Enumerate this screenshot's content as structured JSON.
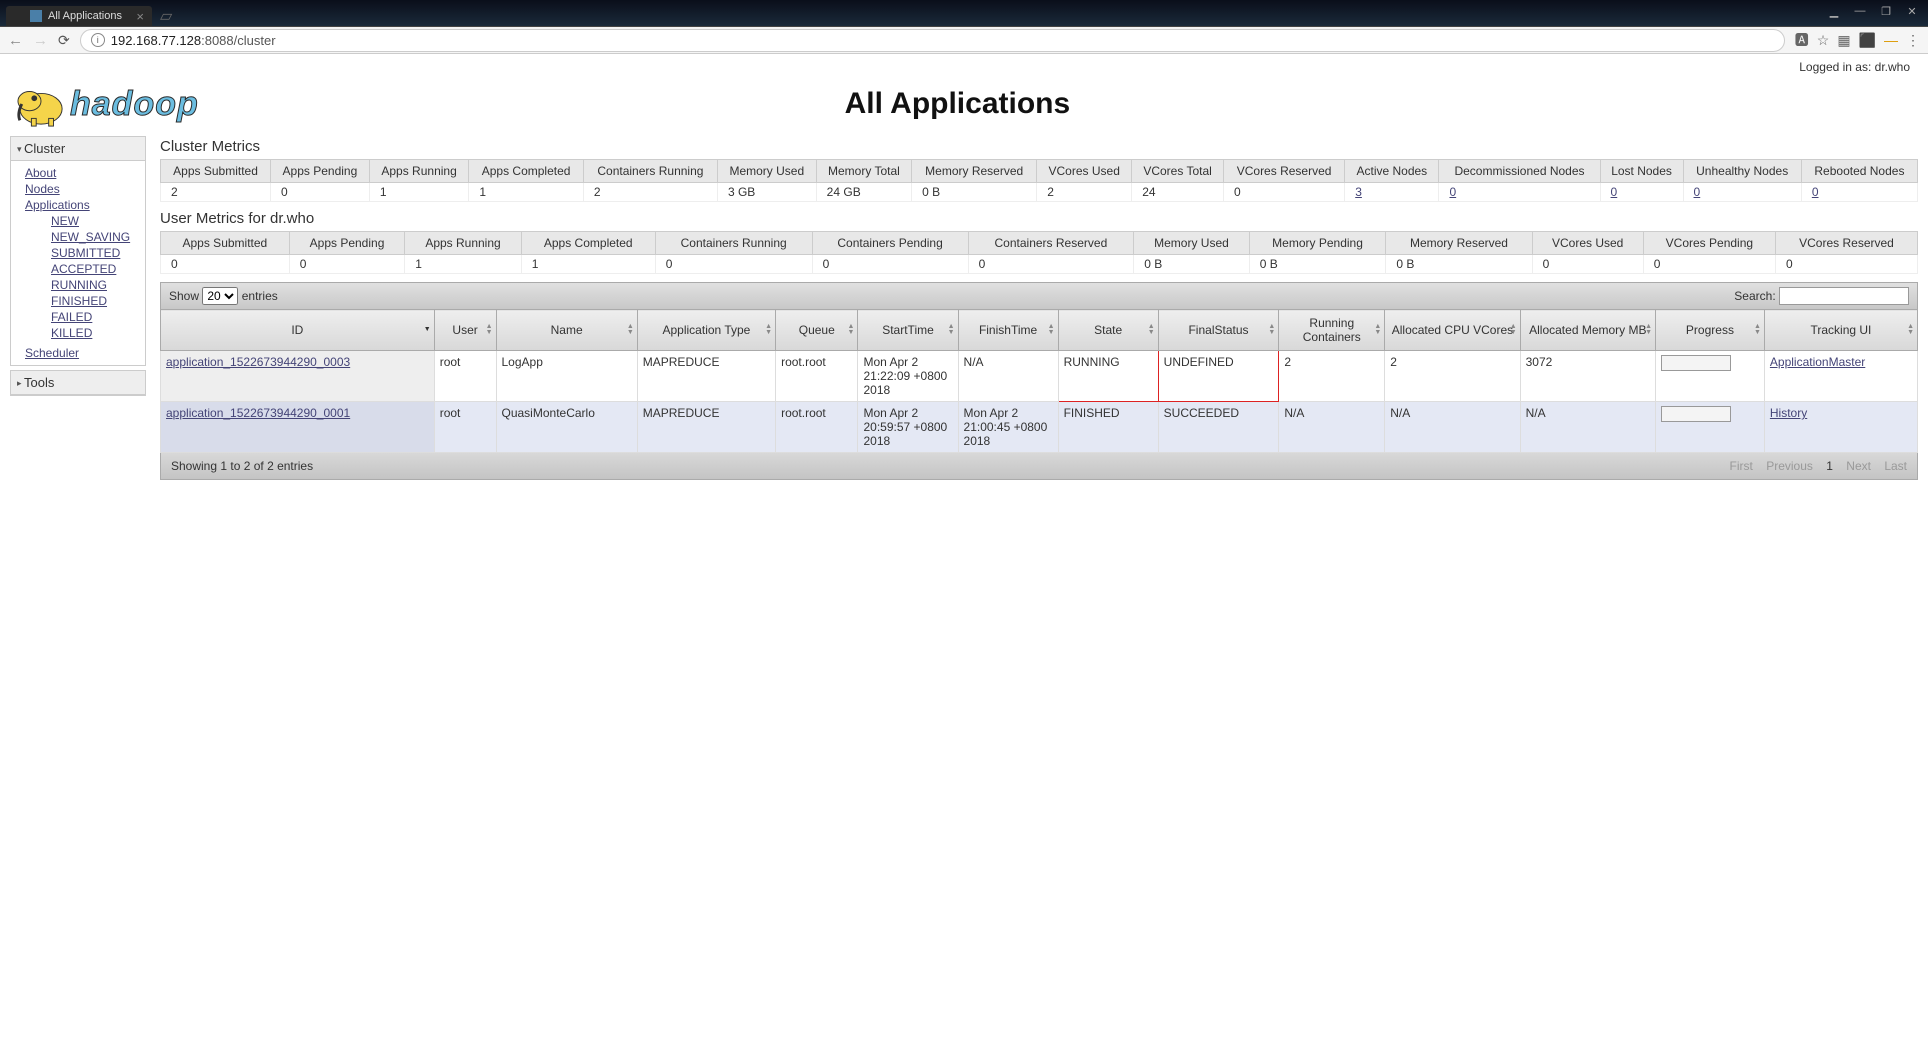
{
  "browser": {
    "tab_title": "All Applications",
    "url_host": "192.168.77.128",
    "url_rest": ":8088/cluster"
  },
  "login": "Logged in as: dr.who",
  "page_title": "All Applications",
  "sidebar": {
    "cluster_hdr": "Cluster",
    "about": "About",
    "nodes": "Nodes",
    "applications": "Applications",
    "states": {
      "new": "NEW",
      "new_saving": "NEW_SAVING",
      "submitted": "SUBMITTED",
      "accepted": "ACCEPTED",
      "running": "RUNNING",
      "finished": "FINISHED",
      "failed": "FAILED",
      "killed": "KILLED"
    },
    "scheduler": "Scheduler",
    "tools_hdr": "Tools"
  },
  "cm_title": "Cluster Metrics",
  "cm_headers": {
    "h0": "Apps Submitted",
    "h1": "Apps Pending",
    "h2": "Apps Running",
    "h3": "Apps Completed",
    "h4": "Containers Running",
    "h5": "Memory Used",
    "h6": "Memory Total",
    "h7": "Memory Reserved",
    "h8": "VCores Used",
    "h9": "VCores Total",
    "h10": "VCores Reserved",
    "h11": "Active Nodes",
    "h12": "Decommissioned Nodes",
    "h13": "Lost Nodes",
    "h14": "Unhealthy Nodes",
    "h15": "Rebooted Nodes"
  },
  "cm": {
    "v0": "2",
    "v1": "0",
    "v2": "1",
    "v3": "1",
    "v4": "2",
    "v5": "3 GB",
    "v6": "24 GB",
    "v7": "0 B",
    "v8": "2",
    "v9": "24",
    "v10": "0",
    "v11": "3",
    "v12": "0",
    "v13": "0",
    "v14": "0",
    "v15": "0"
  },
  "um_title": "User Metrics for dr.who",
  "um_headers": {
    "h0": "Apps Submitted",
    "h1": "Apps Pending",
    "h2": "Apps Running",
    "h3": "Apps Completed",
    "h4": "Containers Running",
    "h5": "Containers Pending",
    "h6": "Containers Reserved",
    "h7": "Memory Used",
    "h8": "Memory Pending",
    "h9": "Memory Reserved",
    "h10": "VCores Used",
    "h11": "VCores Pending",
    "h12": "VCores Reserved"
  },
  "um": {
    "v0": "0",
    "v1": "0",
    "v2": "1",
    "v3": "1",
    "v4": "0",
    "v5": "0",
    "v6": "0",
    "v7": "0 B",
    "v8": "0 B",
    "v9": "0 B",
    "v10": "0",
    "v11": "0",
    "v12": "0"
  },
  "dt": {
    "show": "Show",
    "entries": "entries",
    "page_size": "20",
    "search": "Search:",
    "info": "Showing 1 to 2 of 2 entries",
    "first": "First",
    "prev": "Previous",
    "p1": "1",
    "next": "Next",
    "last": "Last"
  },
  "cols": {
    "id": "ID",
    "user": "User",
    "name": "Name",
    "type": "Application Type",
    "queue": "Queue",
    "start": "StartTime",
    "finish": "FinishTime",
    "state": "State",
    "fstatus": "FinalStatus",
    "rc": "Running Containers",
    "cpu": "Allocated CPU VCores",
    "mem": "Allocated Memory MB",
    "prog": "Progress",
    "track": "Tracking UI"
  },
  "rows": {
    "r0": {
      "id": "application_1522673944290_0003",
      "user": "root",
      "name": "LogApp",
      "type": "MAPREDUCE",
      "queue": "root.root",
      "start": "Mon Apr 2 21:22:09 +0800 2018",
      "finish": "N/A",
      "state": "RUNNING",
      "fstatus": "UNDEFINED",
      "rc": "2",
      "cpu": "2",
      "mem": "3072",
      "track": "ApplicationMaster"
    },
    "r1": {
      "id": "application_1522673944290_0001",
      "user": "root",
      "name": "QuasiMonteCarlo",
      "type": "MAPREDUCE",
      "queue": "root.root",
      "start": "Mon Apr 2 20:59:57 +0800 2018",
      "finish": "Mon Apr 2 21:00:45 +0800 2018",
      "state": "FINISHED",
      "fstatus": "SUCCEEDED",
      "rc": "N/A",
      "cpu": "N/A",
      "mem": "N/A",
      "track": "History"
    }
  }
}
